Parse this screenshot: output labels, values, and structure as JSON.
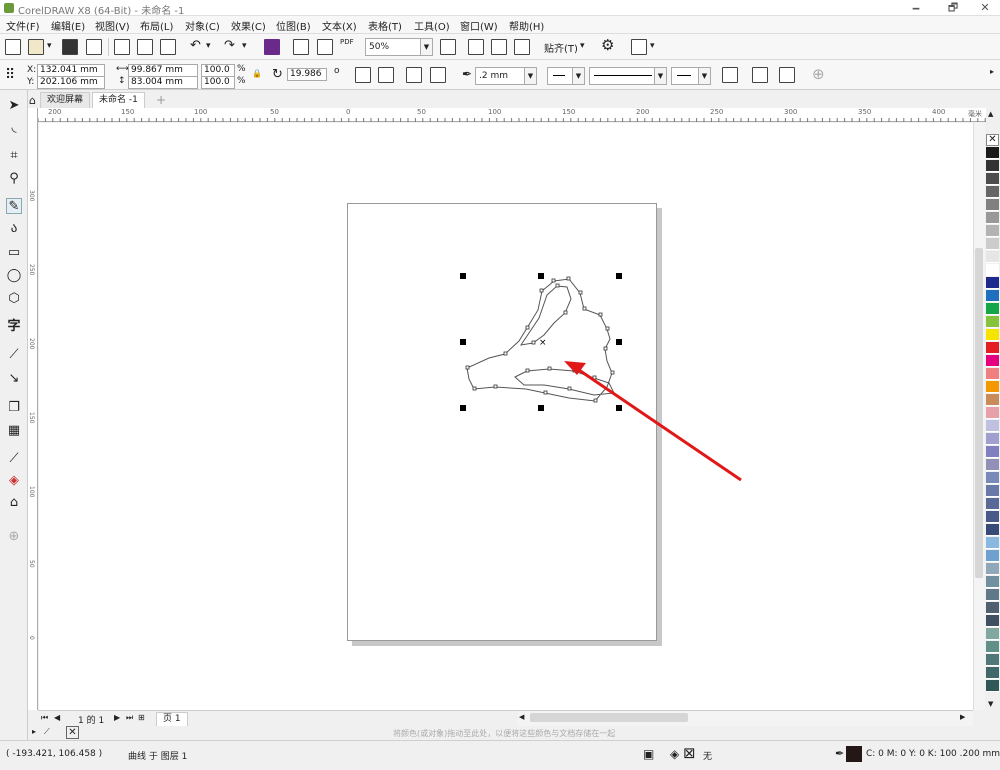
{
  "window": {
    "title": "CorelDRAW X8 (64-Bit) - 未命名 -1",
    "controls": [
      "🗕",
      "🗗",
      "✕"
    ]
  },
  "menu": [
    "文件(F)",
    "编辑(E)",
    "视图(V)",
    "布局(L)",
    "对象(C)",
    "效果(C)",
    "位图(B)",
    "文本(X)",
    "表格(T)",
    "工具(O)",
    "窗口(W)",
    "帮助(H)"
  ],
  "toolbar": {
    "zoom": "50%",
    "snap": "贴齐(T)",
    "pdf": "PDF"
  },
  "property_bar": {
    "x": "132.041 mm",
    "y": "202.106 mm",
    "x_label": "X:",
    "y_label": "Y:",
    "width": "99.867 mm",
    "height": "83.004 mm",
    "scale_x": "100.0",
    "scale_y": "100.0",
    "percent": "%",
    "rotation": "19.986",
    "degree": "o",
    "outline_width": ".2 mm"
  },
  "tabs": [
    {
      "label": "欢迎屏幕"
    },
    {
      "label": "未命名 -1"
    }
  ],
  "ruler_h": [
    "200",
    "150",
    "100",
    "50",
    "0",
    "50",
    "100",
    "150",
    "200",
    "250",
    "300",
    "350",
    "400"
  ],
  "ruler_unit": "毫米",
  "ruler_v": [
    "300",
    "250",
    "200",
    "150",
    "100",
    "50",
    "0"
  ],
  "page_nav": {
    "count": "1 的 1",
    "page_tab": "页 1"
  },
  "doc_palette_hint": "将颜色(或对象)拖动至此处，以便将这些颜色与文档存储在一起",
  "status": {
    "coords": "( -193.421, 106.458 )",
    "object": "曲线 于 图层 1",
    "fill": "无",
    "outline": "C: 0 M: 0 Y: 0 K: 100  .200 mm"
  },
  "colors": {
    "accent": "#6b2a8a",
    "annotation": "#e01818"
  },
  "palette": [
    "#1a1a1a",
    "#333333",
    "#4d4d4d",
    "#666666",
    "#808080",
    "#999999",
    "#b3b3b3",
    "#cccccc",
    "#e6e6e6",
    "#ffffff",
    "#1b2a8c",
    "#1f6fbf",
    "#16a64a",
    "#86c33d",
    "#f4e400",
    "#e31e24",
    "#e4007f",
    "#f08080",
    "#f39800",
    "#c98b5a",
    "#e8a0a8",
    "#c0c0e0",
    "#a0a0d0",
    "#8080c0",
    "#9090b8",
    "#7a8ab8",
    "#6a7aa8",
    "#5a6a98",
    "#4a5a88",
    "#3a4a78",
    "#8bb8e0",
    "#6ea0d0",
    "#90a8b8",
    "#7090a0",
    "#607888",
    "#506070",
    "#405060",
    "#80a8a0",
    "#609088",
    "#507878",
    "#406868",
    "#305858"
  ]
}
